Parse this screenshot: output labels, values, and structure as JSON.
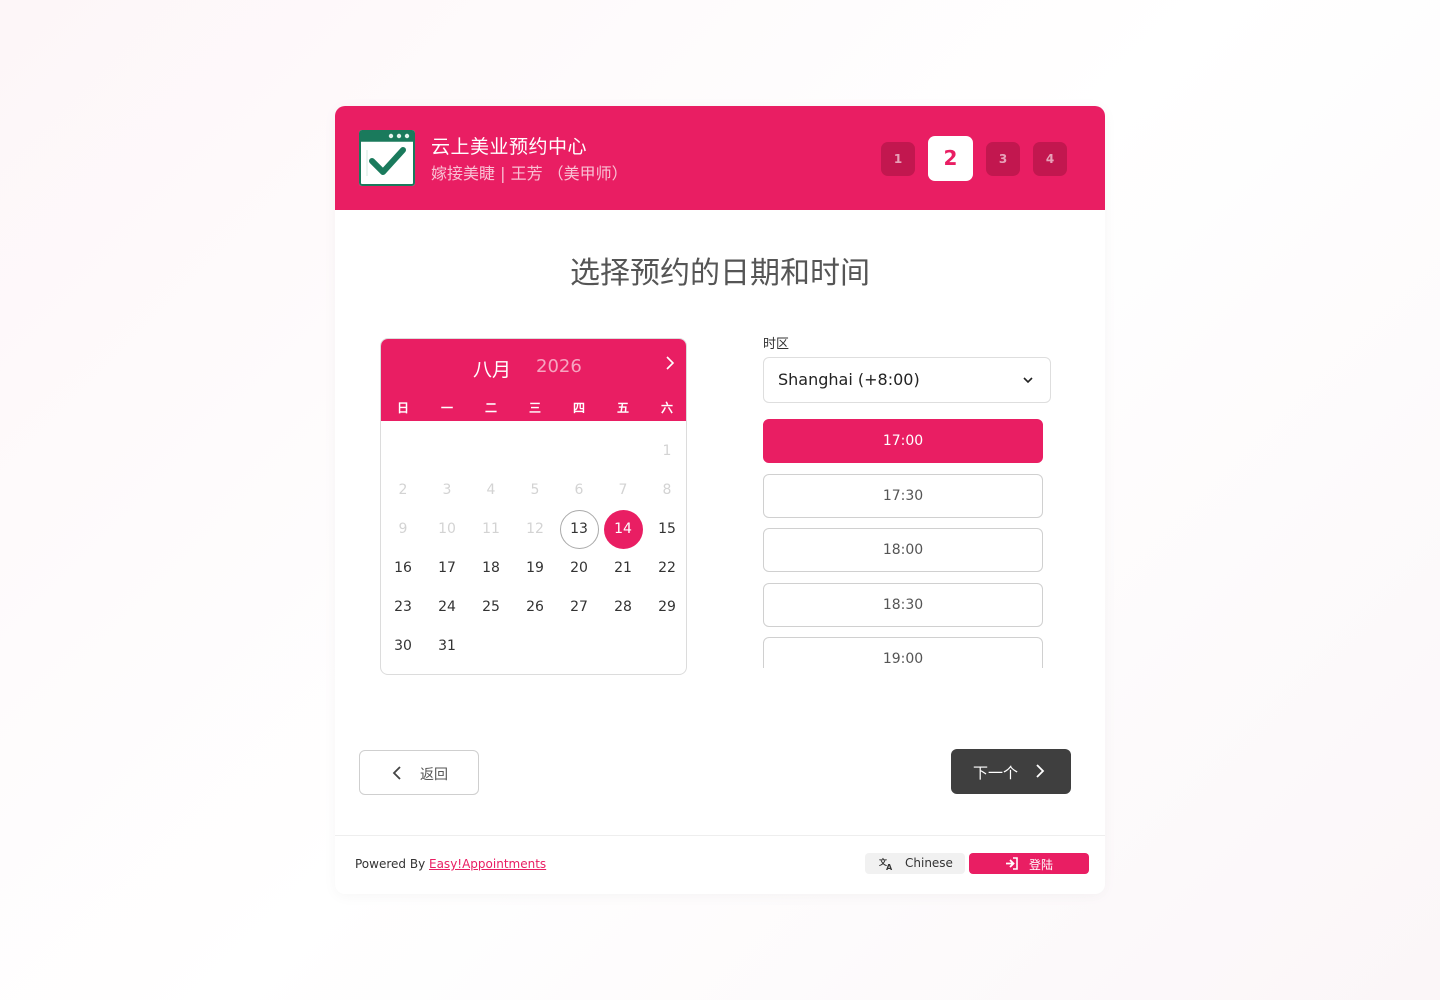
{
  "header": {
    "company_name": "云上美业预约中心",
    "service_line": "嫁接美睫 | 王芳 （美甲师）",
    "logo_icon": "calendar-check-icon",
    "steps": [
      "1",
      "2",
      "3",
      "4"
    ],
    "active_step": 2
  },
  "page_title": "选择预约的日期和时间",
  "calendar": {
    "month": "八月",
    "year": "2026",
    "weekdays": [
      "日",
      "一",
      "二",
      "三",
      "四",
      "五",
      "六"
    ],
    "first_weekday_index": 6,
    "days_in_month": 31,
    "disabled_until": 12,
    "today": 13,
    "selected": 14
  },
  "timezone": {
    "label": "时区",
    "value": "Shanghai (+8:00)"
  },
  "slots": [
    "17:00",
    "17:30",
    "18:00",
    "18:30",
    "19:00"
  ],
  "selected_slot": "17:00",
  "nav": {
    "back_label": "返回",
    "next_label": "下一个"
  },
  "footer": {
    "powered_by": "Powered By",
    "powered_link": "Easy!Appointments",
    "language_label": "Chinese",
    "login_label": "登陆"
  },
  "colors": {
    "primary": "#e91e63",
    "dark_button": "#3f3f3f"
  }
}
